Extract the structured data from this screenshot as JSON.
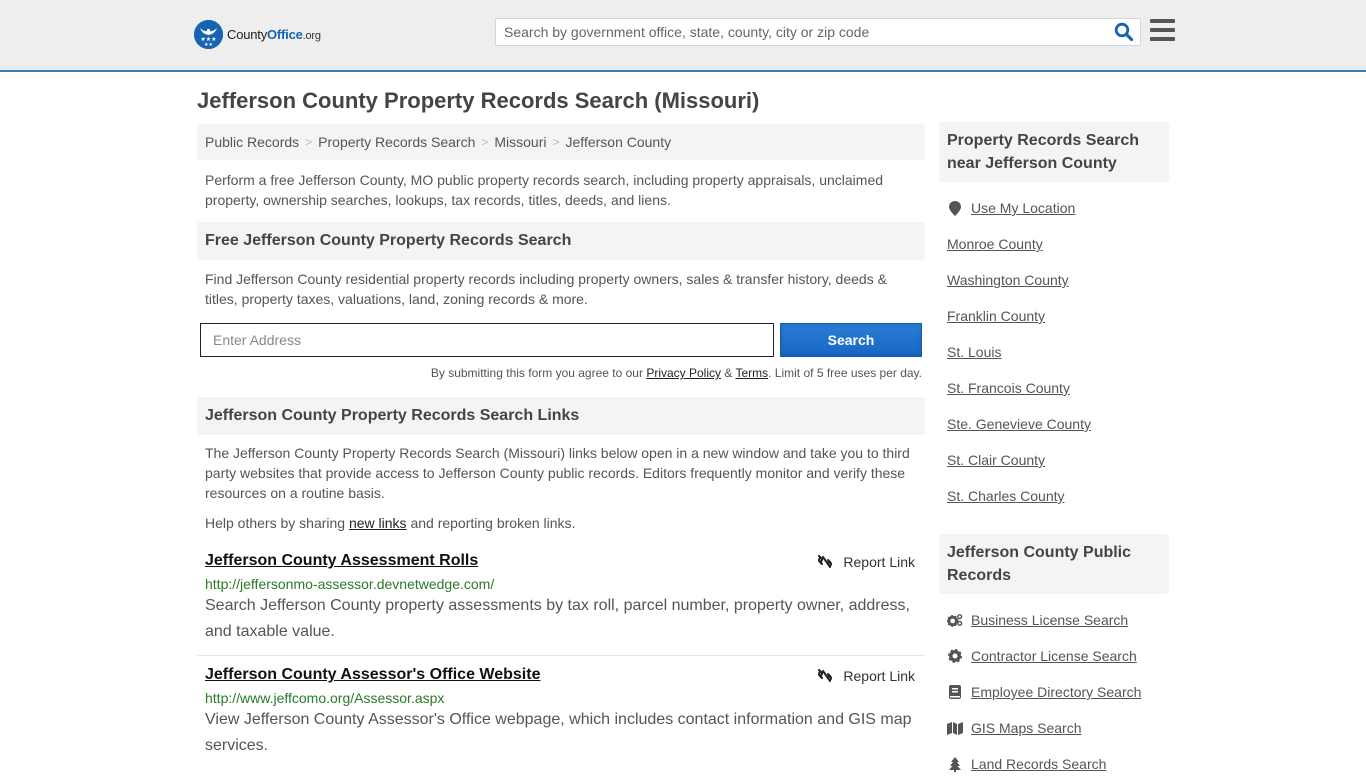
{
  "header": {
    "logo": {
      "county": "County",
      "office": "Office",
      "tld": ".org"
    },
    "search_placeholder": "Search by government office, state, county, city or zip code",
    "search_icon": "search-icon",
    "menu_icon": "hamburger-menu-icon"
  },
  "page_title": "Jefferson County Property Records Search (Missouri)",
  "breadcrumb": [
    "Public Records",
    "Property Records Search",
    "Missouri",
    "Jefferson County"
  ],
  "intro": "Perform a free Jefferson County, MO public property records search, including property appraisals, unclaimed property, ownership searches, lookups, tax records, titles, deeds, and liens.",
  "free_search": {
    "heading": "Free Jefferson County Property Records Search",
    "description": "Find Jefferson County residential property records including property owners, sales & transfer history, deeds & titles, property taxes, valuations, land, zoning records & more.",
    "address_placeholder": "Enter Address",
    "address_value": "",
    "button_label": "Search",
    "terms_prefix": "By submitting this form you agree to our ",
    "privacy_label": "Privacy Policy",
    "terms_amp": " & ",
    "terms_label": "Terms",
    "terms_suffix": ". Limit of 5 free uses per day."
  },
  "links_section": {
    "heading": "Jefferson County Property Records Search Links",
    "description": "The Jefferson County Property Records Search (Missouri) links below open in a new window and take you to third party websites that provide access to Jefferson County public records. Editors frequently monitor and verify these resources on a routine basis.",
    "share_prefix": "Help others by sharing ",
    "share_link": "new links",
    "share_suffix": " and reporting broken links.",
    "report_label": "Report Link",
    "entries": [
      {
        "title": "Jefferson County Assessment Rolls",
        "url": "http://jeffersonmo-assessor.devnetwedge.com/",
        "description": "Search Jefferson County property assessments by tax roll, parcel number, property owner, address, and taxable value."
      },
      {
        "title": "Jefferson County Assessor's Office Website",
        "url": "http://www.jeffcomo.org/Assessor.aspx",
        "description": "View Jefferson County Assessor's Office webpage, which includes contact information and GIS map services."
      }
    ]
  },
  "sidebar": {
    "nearby": {
      "heading": "Property Records Search near Jefferson County",
      "use_location": "Use My Location",
      "items": [
        "Monroe County",
        "Washington County",
        "Franklin County",
        "St. Louis",
        "St. Francois County",
        "Ste. Genevieve County",
        "St. Clair County",
        "St. Charles County"
      ]
    },
    "public_records": {
      "heading": "Jefferson County Public Records",
      "items": [
        {
          "label": "Business License Search",
          "icon": "gears-icon"
        },
        {
          "label": "Contractor License Search",
          "icon": "gear-icon"
        },
        {
          "label": "Employee Directory Search",
          "icon": "book-icon"
        },
        {
          "label": "GIS Maps Search",
          "icon": "map-icon"
        },
        {
          "label": "Land Records Search",
          "icon": "tree-icon"
        }
      ]
    }
  },
  "colors": {
    "brand_blue": "#1565b0",
    "header_border": "#3a7db5",
    "button_blue": "#1f74cd",
    "url_green": "#2a7a2a",
    "heading_bg": "#f4f4f4"
  }
}
